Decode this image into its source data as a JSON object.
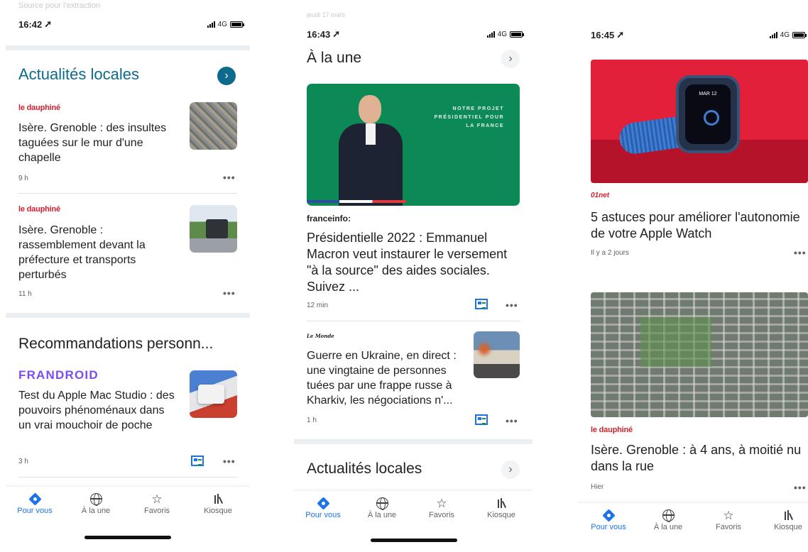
{
  "phone1": {
    "faded_top": "Source pour l'extraction",
    "status": {
      "time": "16:42",
      "network": "4G"
    },
    "local": {
      "title": "Actualités locales",
      "articles": [
        {
          "source": "le dauphiné",
          "headline": "Isère. Grenoble : des insultes taguées sur le mur d'une chapelle",
          "age": "9 h"
        },
        {
          "source": "le dauphiné",
          "headline": "Isère. Grenoble : rassemblement devant la préfecture et transports perturbés",
          "age": "11 h"
        }
      ]
    },
    "reco": {
      "title": "Recommandations personn...",
      "article": {
        "source": "FRANDROID",
        "headline": "Test du Apple Mac Studio : des pouvoirs phénoménaux dans un vrai mouchoir de poche",
        "age": "3 h"
      }
    }
  },
  "phone2": {
    "faded_top": "jeudi 17 mars",
    "status": {
      "time": "16:43",
      "network": "4G"
    },
    "title": "À la une",
    "image_slogan": "NOTRE PROJET\nPRÉSIDENTIEL POUR\nLA FRANCE",
    "main_article": {
      "source": "franceinfo:",
      "headline": "Présidentielle 2022 : Emmanuel Macron veut instaurer le versement \"à la source\" des aides sociales. Suivez ...",
      "age": "12 min"
    },
    "second_article": {
      "source": "Le Monde",
      "headline": "Guerre en Ukraine, en direct : une vingtaine de personnes tuées par une frappe russe à Kharkiv, les négociations n'...",
      "age": "1 h"
    },
    "local_title": "Actualités locales"
  },
  "phone3": {
    "status": {
      "time": "16:45",
      "network": "4G"
    },
    "watch_date": "MAR 12",
    "article1": {
      "source": "01net",
      "headline": "5 astuces pour améliorer l'autonomie de votre Apple Watch",
      "age": "Il y a 2 jours"
    },
    "article2": {
      "source": "le dauphiné",
      "headline": "Isère. Grenoble : à 4 ans, à moitié nu dans la rue",
      "age": "Hier"
    }
  },
  "tabs": [
    {
      "label": "Pour vous",
      "icon": "pour-vous-icon"
    },
    {
      "label": "À la une",
      "icon": "globe-icon"
    },
    {
      "label": "Favoris",
      "icon": "star-icon"
    },
    {
      "label": "Kiosque",
      "icon": "kiosque-icon"
    }
  ],
  "colors": {
    "accent": "#1a73e8",
    "dauphine_red": "#d01f2c",
    "frandroid_purple": "#7b4cf5",
    "local_chevron": "#0e6a8a"
  }
}
